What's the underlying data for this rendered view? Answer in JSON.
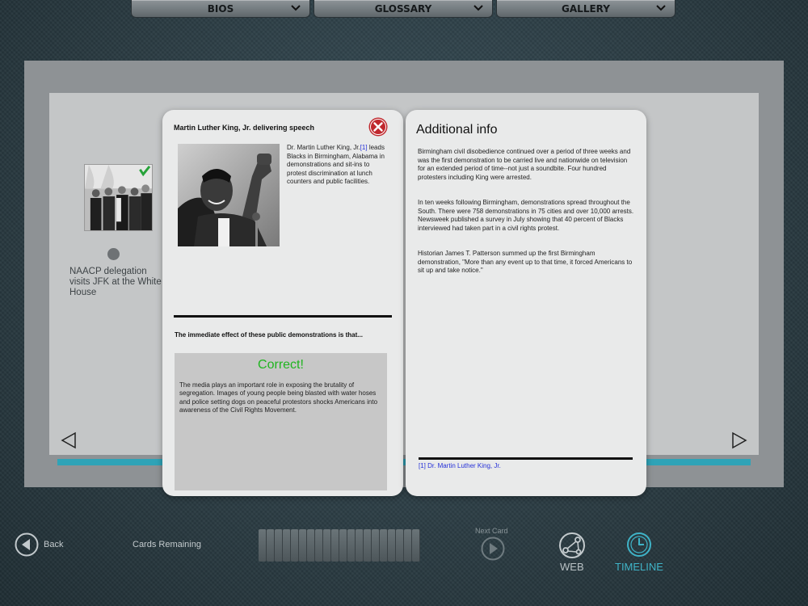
{
  "menu": {
    "tabs": [
      {
        "label": "BIOS"
      },
      {
        "label": "GLOSSARY"
      },
      {
        "label": "GALLERY"
      }
    ]
  },
  "timeline": {
    "caption": "NAACP delegation visits JFK at the White House"
  },
  "card": {
    "title": "Martin Luther King, Jr. delivering speech",
    "desc_pre": "Dr. Martin Luther King, Jr.",
    "desc_ref": "[1]",
    "desc_post": " leads Blacks in Birmingham, Alabama in demonstrations and sit-ins to protest discrimination at lunch counters and public facilities.",
    "question": "The immediate effect of these public demonstrations is that...",
    "result": "Correct!",
    "answer": "The media plays an important role in exposing the brutality of segregation. Images of young people being blasted with water hoses and police setting dogs on peaceful protestors shocks Americans into awareness of the Civil Rights Movement."
  },
  "info": {
    "title": "Additional info",
    "paragraphs": [
      "Birmingham civil disobedience continued over a period of three weeks and was the first demonstration to be carried live and nationwide on television for an extended period of time--not just a soundbite. Four hundred protesters including King were arrested.",
      "In ten weeks following Birmingham, demonstrations spread throughout the South. There were 758 demonstrations in 75 cities and over 10,000 arrests. Newsweek published a survey in July showing that 40 percent of Blacks interviewed had taken part in a civil rights protest.",
      "Historian James T. Patterson summed up the first Birmingham demonstration, \"More than any event up to that time, it forced Americans to sit up and take notice.\""
    ],
    "footnote": "[1] Dr. Martin Luther King, Jr."
  },
  "bottom": {
    "back": "Back",
    "cards_remaining": "Cards Remaining",
    "next_card": "Next Card",
    "web": "WEB",
    "timeline": "TIMELINE"
  },
  "colors": {
    "accent": "#3fb3c7",
    "correct": "#1fb51f",
    "link": "#2530d8",
    "close": "#c0282d"
  }
}
